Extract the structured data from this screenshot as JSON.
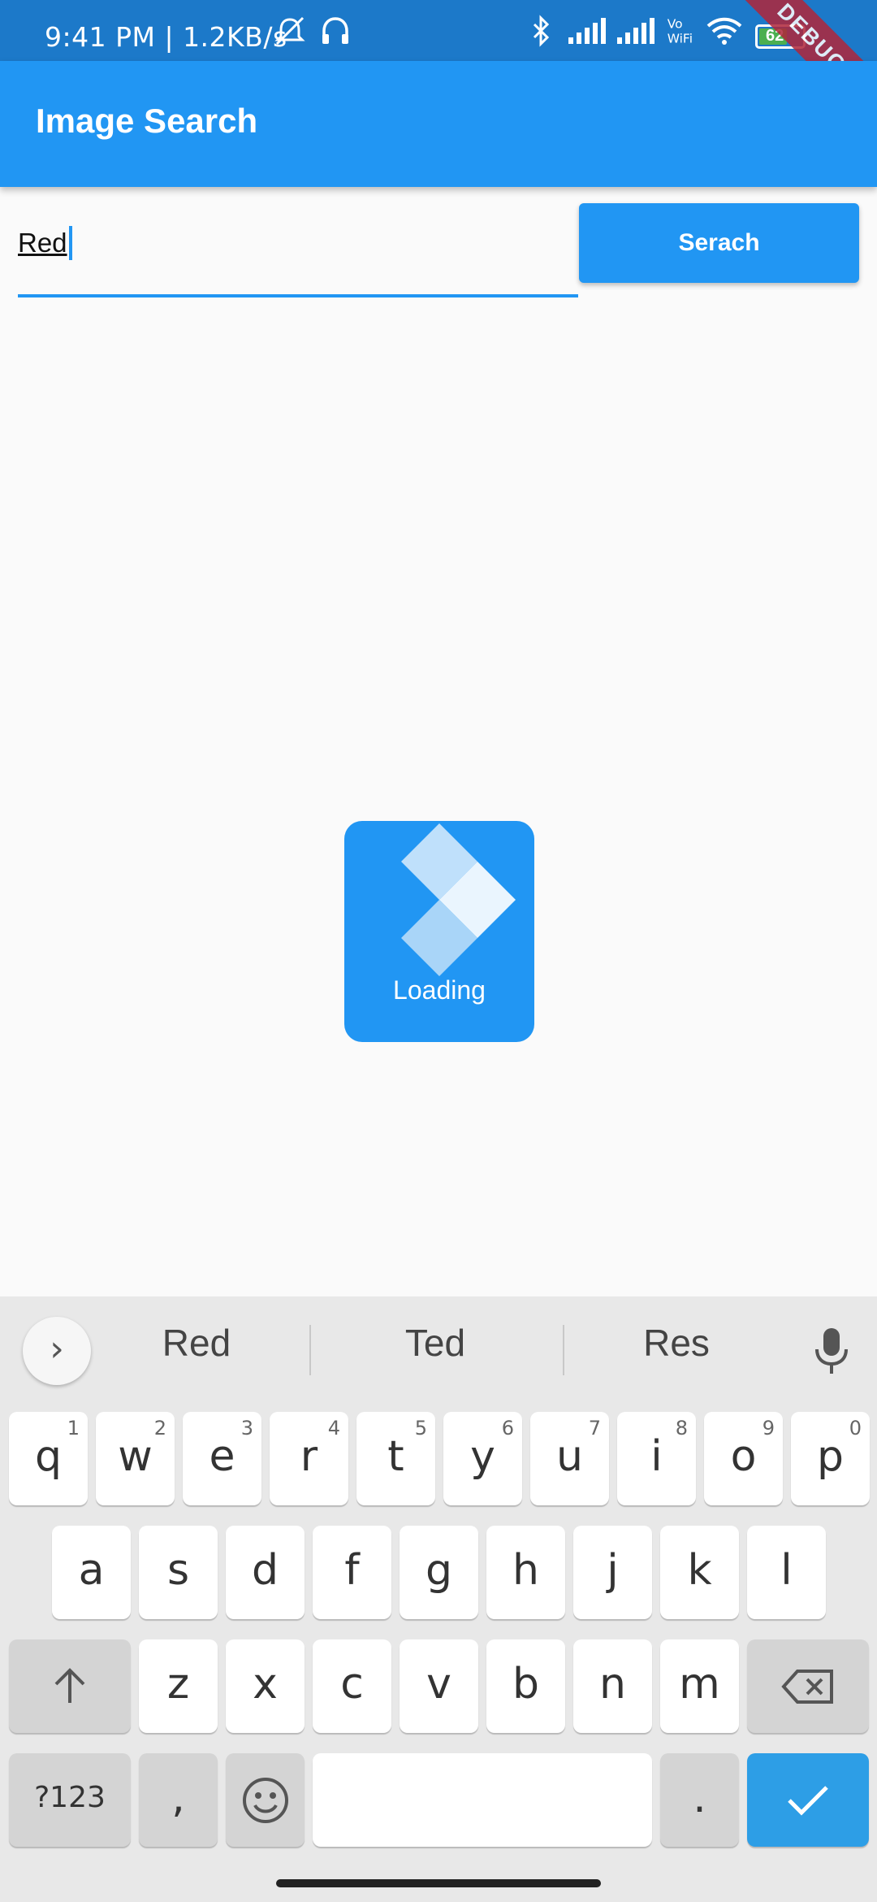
{
  "status_bar": {
    "left_text": "9:41 PM | 1.2KB/s",
    "battery": "62",
    "debug_label": "DEBUG"
  },
  "app_bar": {
    "title": "Image Search"
  },
  "search": {
    "value": "Red",
    "button_label": "Serach"
  },
  "loading": {
    "label": "Loading"
  },
  "keyboard": {
    "suggestions": [
      "Red",
      "Ted",
      "Res"
    ],
    "row1": [
      {
        "key": "q",
        "sup": "1"
      },
      {
        "key": "w",
        "sup": "2"
      },
      {
        "key": "e",
        "sup": "3"
      },
      {
        "key": "r",
        "sup": "4"
      },
      {
        "key": "t",
        "sup": "5"
      },
      {
        "key": "y",
        "sup": "6"
      },
      {
        "key": "u",
        "sup": "7"
      },
      {
        "key": "i",
        "sup": "8"
      },
      {
        "key": "o",
        "sup": "9"
      },
      {
        "key": "p",
        "sup": "0"
      }
    ],
    "row2": [
      "a",
      "s",
      "d",
      "f",
      "g",
      "h",
      "j",
      "k",
      "l"
    ],
    "row3": [
      "z",
      "x",
      "c",
      "v",
      "b",
      "n",
      "m"
    ],
    "symbols_label": "?123",
    "comma_label": ",",
    "period_label": "."
  },
  "colors": {
    "primary": "#2196f3",
    "status_bar": "#1c79c9",
    "enter_key": "#2d9ee6"
  }
}
